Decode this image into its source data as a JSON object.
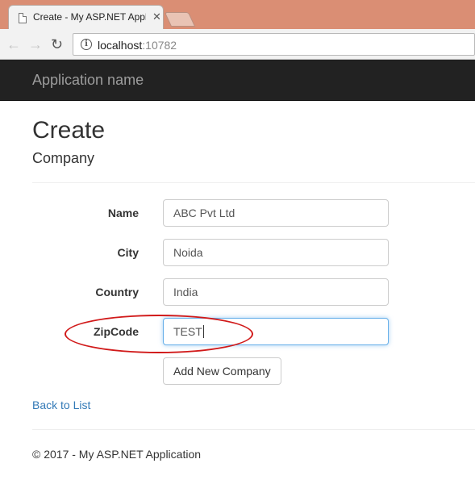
{
  "browser": {
    "tab_title": "Create - My ASP.NET Application",
    "tab_close": "✕",
    "url_host": "localhost",
    "url_port": ":10782"
  },
  "navbar": {
    "brand": "Application name"
  },
  "page": {
    "title": "Create",
    "subtitle": "Company"
  },
  "form": {
    "fields": [
      {
        "label": "Name",
        "value": "ABC Pvt Ltd"
      },
      {
        "label": "City",
        "value": "Noida"
      },
      {
        "label": "Country",
        "value": "India"
      },
      {
        "label": "ZipCode",
        "value": "TEST"
      }
    ],
    "submit_label": "Add New Company"
  },
  "back_link": "Back to List",
  "footer": "© 2017 - My ASP.NET Application",
  "colors": {
    "tabstrip": "#da8e74",
    "navbar": "#222222",
    "link": "#337ab7",
    "annotation": "#d11a1a",
    "focus": "#66afe9"
  }
}
